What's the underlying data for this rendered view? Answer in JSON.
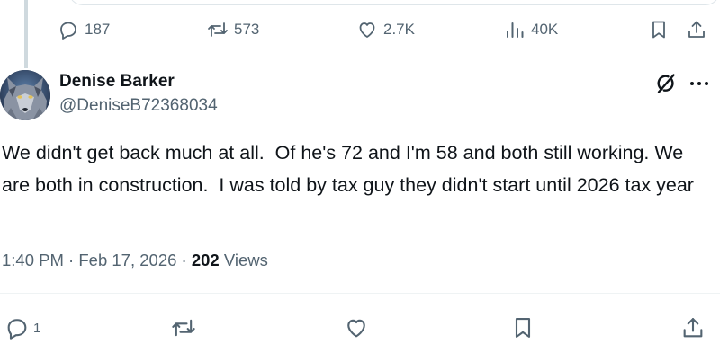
{
  "parent_actions": {
    "replies": "187",
    "reposts": "573",
    "likes": "2.7K",
    "views": "40K"
  },
  "tweet": {
    "author_name": "Denise Barker",
    "author_handle": "@DeniseB72368034",
    "text": "We didn't get back much at all.  Of he's 72 and I'm 58 and both still working. We are both in construction.  I was told by tax guy they didn't start until 2026 tax year",
    "time": "1:40 PM",
    "date": "Feb 17, 2026",
    "views_count": "202",
    "views_label": "Views"
  },
  "actions": {
    "replies": "1"
  },
  "colors": {
    "text_primary": "#0f1419",
    "text_secondary": "#536471",
    "divider": "#eff3f4"
  },
  "icons": {
    "reply": "reply-bubble-icon",
    "repost": "repost-arrows-icon",
    "like": "heart-icon",
    "views": "analytics-bars-icon",
    "bookmark": "bookmark-icon",
    "share": "share-upload-icon",
    "grok": "grok-slash-icon",
    "more": "more-dots-icon"
  }
}
